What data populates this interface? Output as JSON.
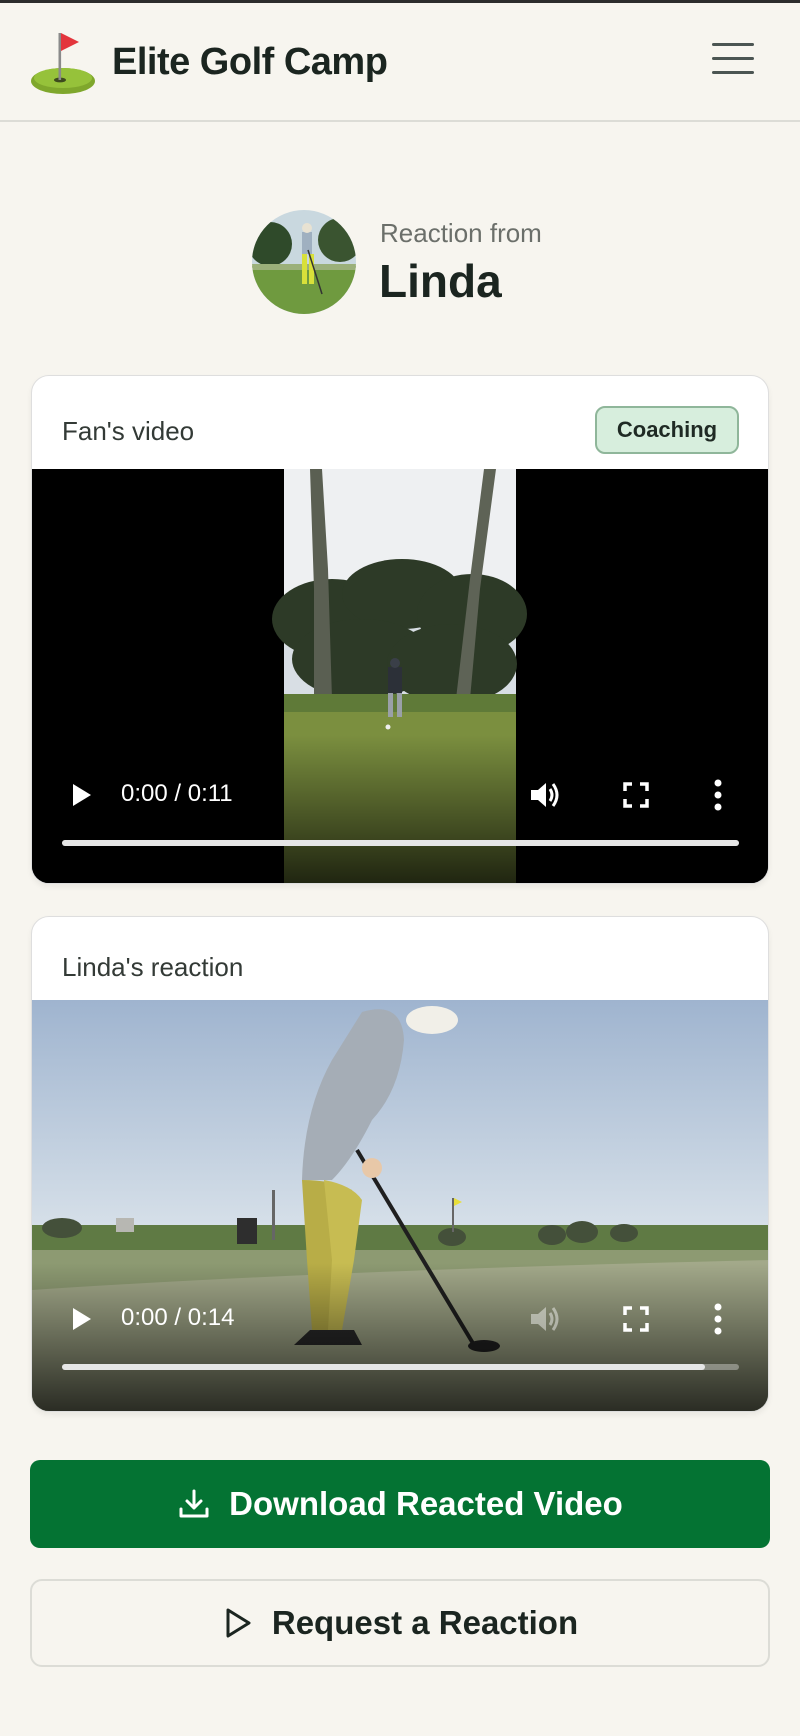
{
  "header": {
    "brand": "Elite Golf Camp",
    "logo_icon": "golf-flag-icon",
    "menu_icon": "hamburger-menu-icon"
  },
  "profile": {
    "label": "Reaction from",
    "name": "Linda"
  },
  "fan_video": {
    "title": "Fan's video",
    "badge": "Coaching",
    "time": "0:00 / 0:11",
    "progress": 1.0
  },
  "reaction_video": {
    "title": "Linda's reaction",
    "time": "0:00 / 0:14",
    "progress": 0.95
  },
  "actions": {
    "download_label": "Download Reacted Video",
    "request_label": "Request a Reaction"
  },
  "colors": {
    "background": "#f7f5ef",
    "primary": "#047333",
    "badge_bg": "#d7eedd",
    "badge_border": "#8fb69a"
  }
}
